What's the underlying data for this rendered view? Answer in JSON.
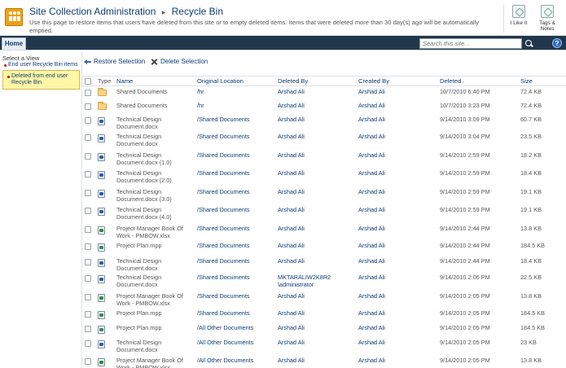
{
  "header": {
    "breadcrumb_root": "Site Collection Administration",
    "breadcrumb_separator": "▸",
    "breadcrumb_current": "Recycle Bin",
    "description": "Use this page to restore items that users have deleted from this site or to empty deleted items. Items that were deleted more than 30 day(s) ago will be automatically emptied.",
    "i_like_it_label": "I Like It",
    "tags_notes_label_1": "Tags &",
    "tags_notes_label_2": "Notes"
  },
  "ribbon": {
    "home_tab": "Home",
    "search_placeholder": "Search this site...",
    "help_label": "?"
  },
  "left_nav": {
    "select_view_label": "Select a View",
    "items": [
      {
        "label": "End user Recycle Bin items",
        "selected": false
      },
      {
        "label": "Deleted from end user Recycle Bin",
        "selected": true
      }
    ]
  },
  "toolbar": {
    "restore_label": "Restore Selection",
    "delete_label": "Delete Selection"
  },
  "table": {
    "columns": {
      "type": "Type",
      "name": "Name",
      "original_location": "Original Location",
      "deleted_by": "Deleted By",
      "created_by": "Created By",
      "deleted": "Deleted",
      "deleted_sort": "↓",
      "size": "Size"
    },
    "rows": [
      {
        "icon": "folder-icon",
        "name": "Shared Documents",
        "location": "/hr",
        "deleted_by": "Arshad Ali",
        "created_by": "Arshad Ali",
        "deleted": "10/7/2010 6:40 PM",
        "size": "72.4 KB"
      },
      {
        "icon": "folder-icon",
        "name": "Shared Documents",
        "location": "/hr",
        "deleted_by": "Arshad Ali",
        "created_by": "Arshad Ali",
        "deleted": "10/7/2010 3:23 PM",
        "size": "72.4 KB"
      },
      {
        "icon": "word-doc-icon",
        "name": "Technical Design Document.docx",
        "location": "/Shared Documents",
        "deleted_by": "Arshad Ali",
        "created_by": "Arshad Ali",
        "deleted": "9/14/2010 3:09 PM",
        "size": "60.7 KB"
      },
      {
        "icon": "word-doc-icon",
        "name": "Technical Design Document.docx",
        "location": "/Shared Documents",
        "deleted_by": "Arshad Ali",
        "created_by": "Arshad Ali",
        "deleted": "9/14/2010 3:04 PM",
        "size": "23.5 KB"
      },
      {
        "icon": "word-doc-icon",
        "name": "Technical Design Document.docx (1.0)",
        "location": "/Shared Documents",
        "deleted_by": "Arshad Ali",
        "created_by": "Arshad Ali",
        "deleted": "9/14/2010 2:59 PM",
        "size": "18.2 KB"
      },
      {
        "icon": "word-doc-icon",
        "name": "Technical Design Document.docx (2.0)",
        "location": "/Shared Documents",
        "deleted_by": "Arshad Ali",
        "created_by": "Arshad Ali",
        "deleted": "9/14/2010 2:59 PM",
        "size": "18.4 KB"
      },
      {
        "icon": "word-doc-icon",
        "name": "Technical Design Document.docx (3.0)",
        "location": "/Shared Documents",
        "deleted_by": "Arshad Ali",
        "created_by": "Arshad Ali",
        "deleted": "9/14/2010 2:59 PM",
        "size": "19.1 KB"
      },
      {
        "icon": "word-doc-icon",
        "name": "Technical Design Document.docx (4.0)",
        "location": "/Shared Documents",
        "deleted_by": "Arshad Ali",
        "created_by": "Arshad Ali",
        "deleted": "9/14/2010 2:59 PM",
        "size": "19.1 KB"
      },
      {
        "icon": "excel-doc-icon",
        "name": "Project Manager Book Of Work - PMBOW.xlsx",
        "location": "/Shared Documents",
        "deleted_by": "Arshad Ali",
        "created_by": "Arshad Ali",
        "deleted": "9/14/2010 2:44 PM",
        "size": "13.8 KB"
      },
      {
        "icon": "project-doc-icon",
        "name": "Project Plan.mpp",
        "location": "/Shared Documents",
        "deleted_by": "Arshad Ali",
        "created_by": "Arshad Ali",
        "deleted": "9/14/2010 2:44 PM",
        "size": "184.5 KB"
      },
      {
        "icon": "word-doc-icon",
        "name": "Technical Design Document.docx",
        "location": "/Shared Documents",
        "deleted_by": "Arshad Ali",
        "created_by": "Arshad Ali",
        "deleted": "9/14/2010 2:44 PM",
        "size": "18.4 KB"
      },
      {
        "icon": "word-doc-icon",
        "name": "Technical Design Document.docx",
        "location": "/Shared Documents",
        "deleted_by": "MKTARALIW2K8R2 \\administrator",
        "created_by": "Arshad Ali",
        "deleted": "9/14/2010 2:06 PM",
        "size": "22.5 KB"
      },
      {
        "icon": "excel-doc-icon",
        "name": "Project Manager Book Of Work - PMBOW.xlsx",
        "location": "/Shared Documents",
        "deleted_by": "Arshad Ali",
        "created_by": "Arshad Ali",
        "deleted": "9/14/2010 2:05 PM",
        "size": "13.8 KB"
      },
      {
        "icon": "project-doc-icon",
        "name": "Project Plan.mpp",
        "location": "/Shared Documents",
        "deleted_by": "Arshad Ali",
        "created_by": "Arshad Ali",
        "deleted": "9/14/2010 2:05 PM",
        "size": "184.5 KB"
      },
      {
        "icon": "project-doc-icon",
        "name": "Project Plan.mpp",
        "location": "/All Other Documents",
        "deleted_by": "Arshad Ali",
        "created_by": "Arshad Ali",
        "deleted": "9/14/2010 2:05 PM",
        "size": "184.5 KB"
      },
      {
        "icon": "word-doc-icon",
        "name": "Technical Design Document.docx",
        "location": "/All Other Documents",
        "deleted_by": "Arshad Ali",
        "created_by": "Arshad Ali",
        "deleted": "9/14/2010 2:05 PM",
        "size": "23 KB"
      },
      {
        "icon": "excel-doc-icon",
        "name": "Project Manager Book Of Work - PMBOW.xlsx",
        "location": "/All Other Documents",
        "deleted_by": "Arshad Ali",
        "created_by": "Arshad Ali",
        "deleted": "9/14/2010 2:05 PM",
        "size": "13.8 KB"
      }
    ]
  }
}
